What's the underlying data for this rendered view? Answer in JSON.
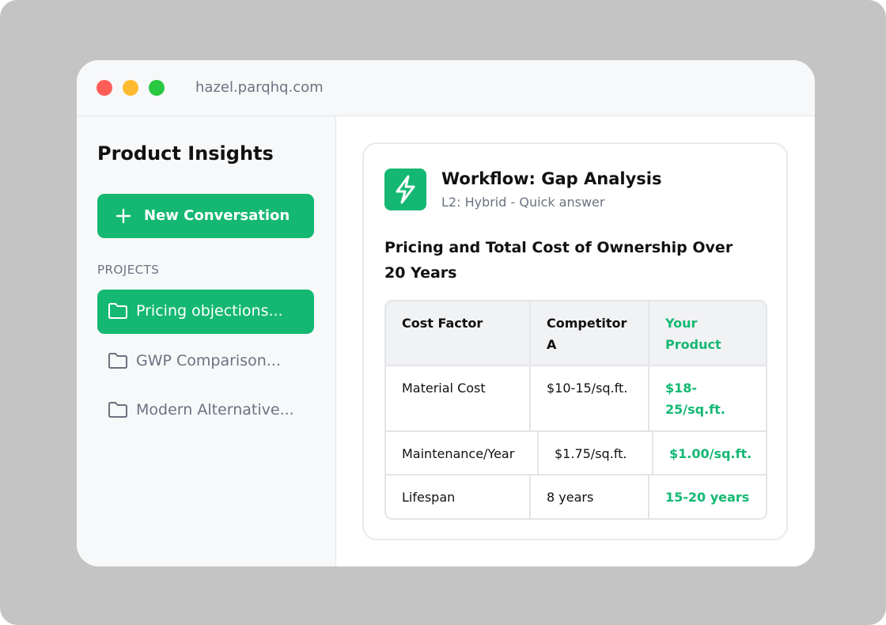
{
  "browser": {
    "url": "hazel.parqhq.com"
  },
  "sidebar": {
    "title": "Product Insights",
    "new_conversation_label": "New Conversation",
    "projects_label": "PROJECTS",
    "projects": [
      {
        "label": "Pricing objections...",
        "active": true
      },
      {
        "label": "GWP Comparison...",
        "active": false
      },
      {
        "label": "Modern Alternative...",
        "active": false
      }
    ]
  },
  "workflow": {
    "icon": "lightning-bolt-icon",
    "title": "Workflow: Gap Analysis",
    "subtitle": "L2: Hybrid - Quick answer",
    "heading": "Pricing and Total Cost of Ownership Over 20 Years"
  },
  "table": {
    "headers": [
      "Cost Factor",
      "Competitor A",
      "Your Product"
    ],
    "rows": [
      [
        "Material Cost",
        "$10-15/sq.ft.",
        "$18-25/sq.ft."
      ],
      [
        "Maintenance/Year",
        "$1.75/sq.ft.",
        "$1.00/sq.ft."
      ],
      [
        "Lifespan",
        "8 years",
        "15-20 years"
      ]
    ]
  },
  "colors": {
    "accent": "#14b872",
    "window_close": "#fe5e57",
    "window_minimize": "#febb2f",
    "window_maximize": "#28c840"
  }
}
